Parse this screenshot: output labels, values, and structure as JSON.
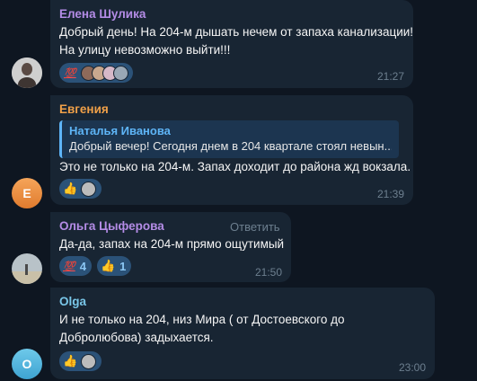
{
  "colors": {
    "background": "#0e1621",
    "bubble": "#182533",
    "reaction_pill": "#2b5278",
    "sender_elena": "#b48ce6",
    "sender_evgenia": "#f0a048",
    "sender_olga_ts": "#b48ce6",
    "sender_olga": "#79c6e8",
    "quote_accent": "#5eb5f7",
    "time": "#6d7f8f"
  },
  "messages": [
    {
      "sender": "Елена Шулика",
      "lines": [
        "Добрый день! На 204-м дышать нечем от запаха канализации!",
        "На улицу невозможно выйти!!!"
      ],
      "reaction_emoji": "💯",
      "time": "21:27"
    },
    {
      "sender": "Евгения",
      "avatar_letter": "Е",
      "quote_name": "Наталья Иванова",
      "quote_text": "Добрый вечер! Сегодня днем в 204 квартале стоял невын...",
      "lines": [
        "Это не только на 204-м. Запах доходит до района жд вокзала."
      ],
      "reaction_emoji": "👍",
      "time": "21:39"
    },
    {
      "sender": "Ольга Цыферова",
      "reply_label": "Ответить",
      "lines": [
        "Да-да, запах на 204-м прямо ощутимый"
      ],
      "reactions": [
        {
          "emoji": "💯",
          "count": "4"
        },
        {
          "emoji": "👍",
          "count": "1"
        }
      ],
      "time": "21:50"
    },
    {
      "sender": "Olga",
      "avatar_letter": "O",
      "lines": [
        "И не только на 204, низ Мира ( от Достоевского до",
        "Добролюбова) задыхается."
      ],
      "reaction_emoji": "👍",
      "time": "23:00"
    }
  ]
}
